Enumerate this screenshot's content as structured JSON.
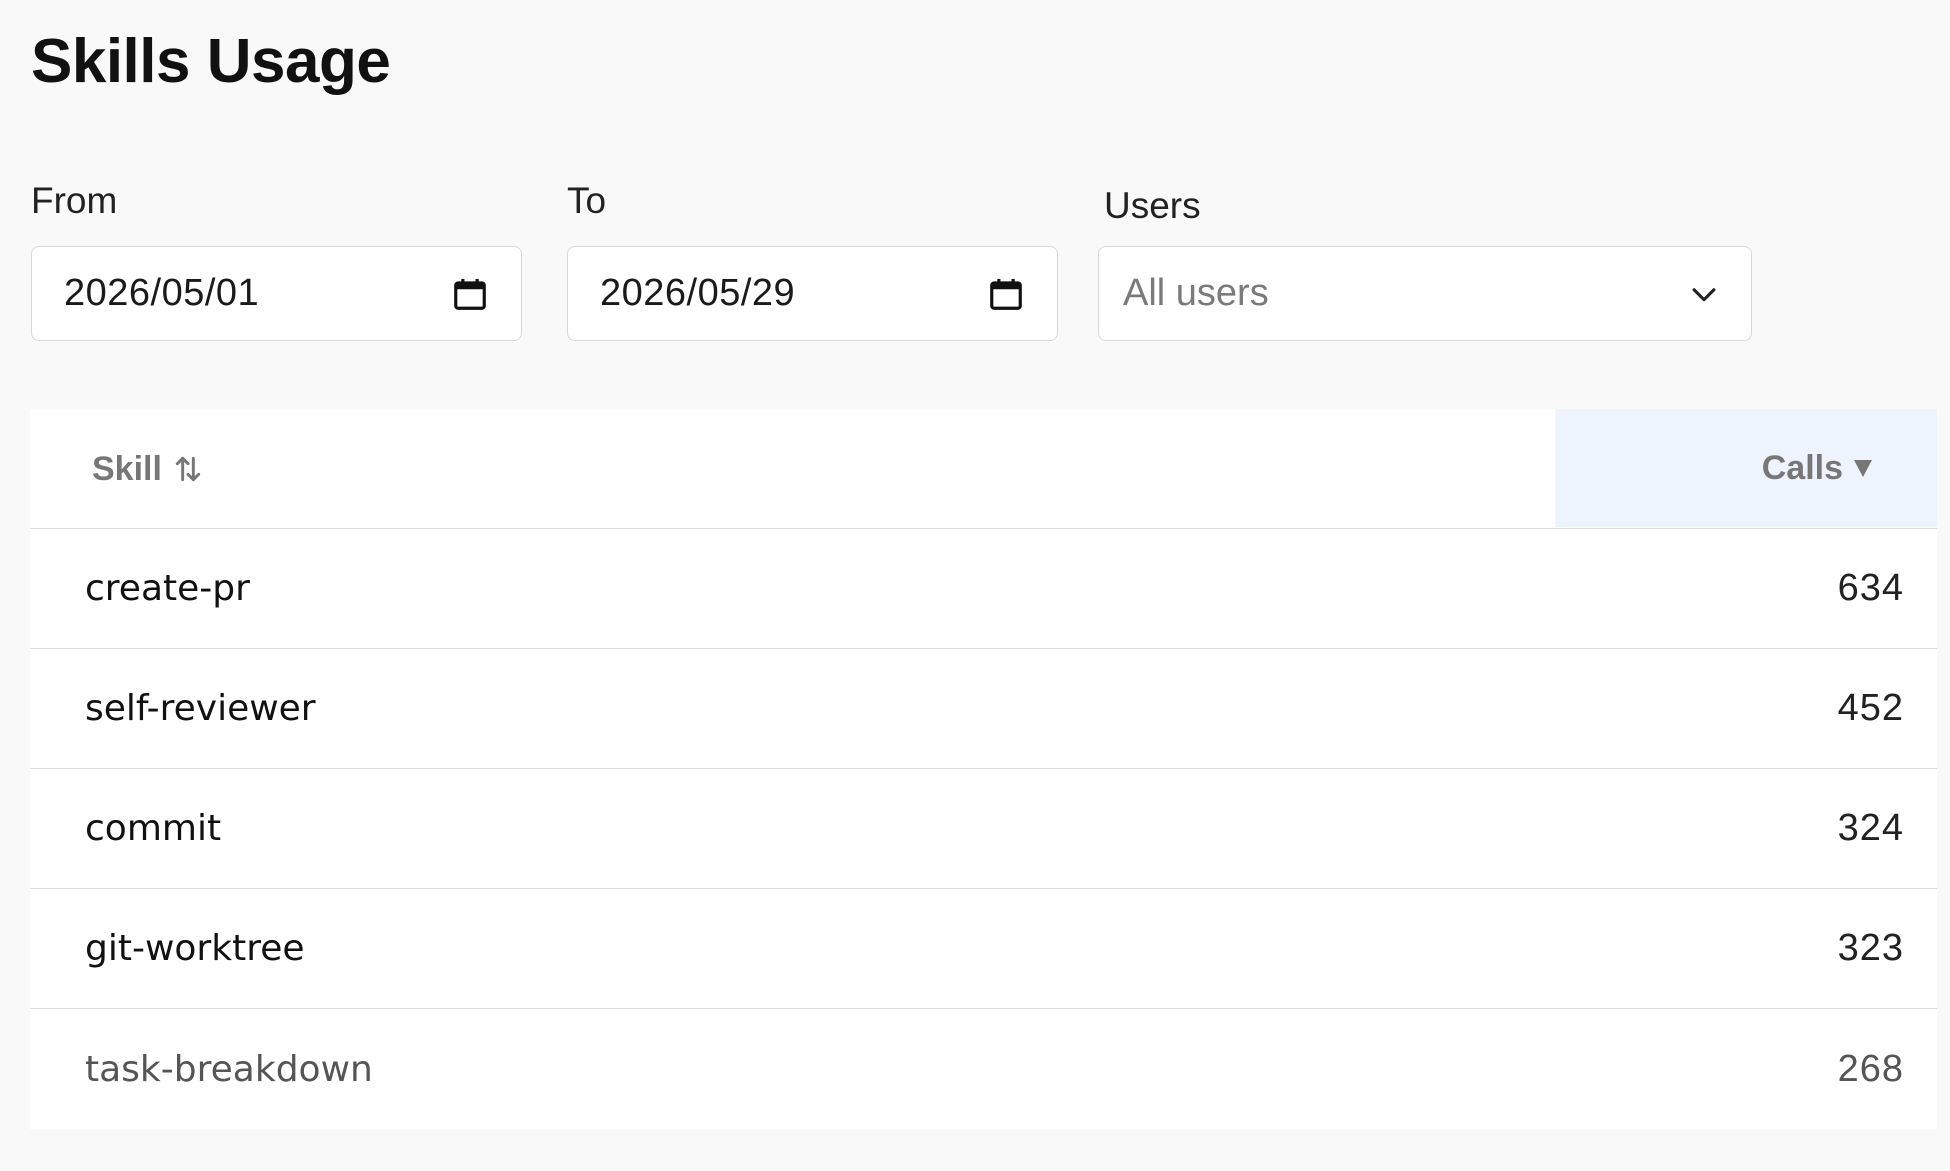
{
  "page": {
    "title": "Skills Usage"
  },
  "filters": {
    "from_label": "From",
    "from_value": "2026/05/01",
    "to_label": "To",
    "to_value": "2026/05/29",
    "users_label": "Users",
    "users_value": "All users"
  },
  "icons": {
    "date_picker": "calendar-icon",
    "select": "chevron-down-icon",
    "sortable": "sort-up-down-icon",
    "sorted_desc": "caret-down-icon"
  },
  "table": {
    "columns": {
      "skill": "Skill",
      "calls": "Calls"
    },
    "sorted_column": "Calls",
    "sort_direction": "descending",
    "rows": [
      {
        "skill": "create-pr",
        "calls": "634"
      },
      {
        "skill": "self-reviewer",
        "calls": "452"
      },
      {
        "skill": "commit",
        "calls": "324"
      },
      {
        "skill": "git-worktree",
        "calls": "323"
      },
      {
        "skill": "task-breakdown",
        "calls": "268"
      }
    ]
  },
  "colors": {
    "page_background": "#f9f9f9",
    "sorted_header_background": "#edf4fd",
    "header_text": "#777777",
    "border": "#dddddd"
  }
}
